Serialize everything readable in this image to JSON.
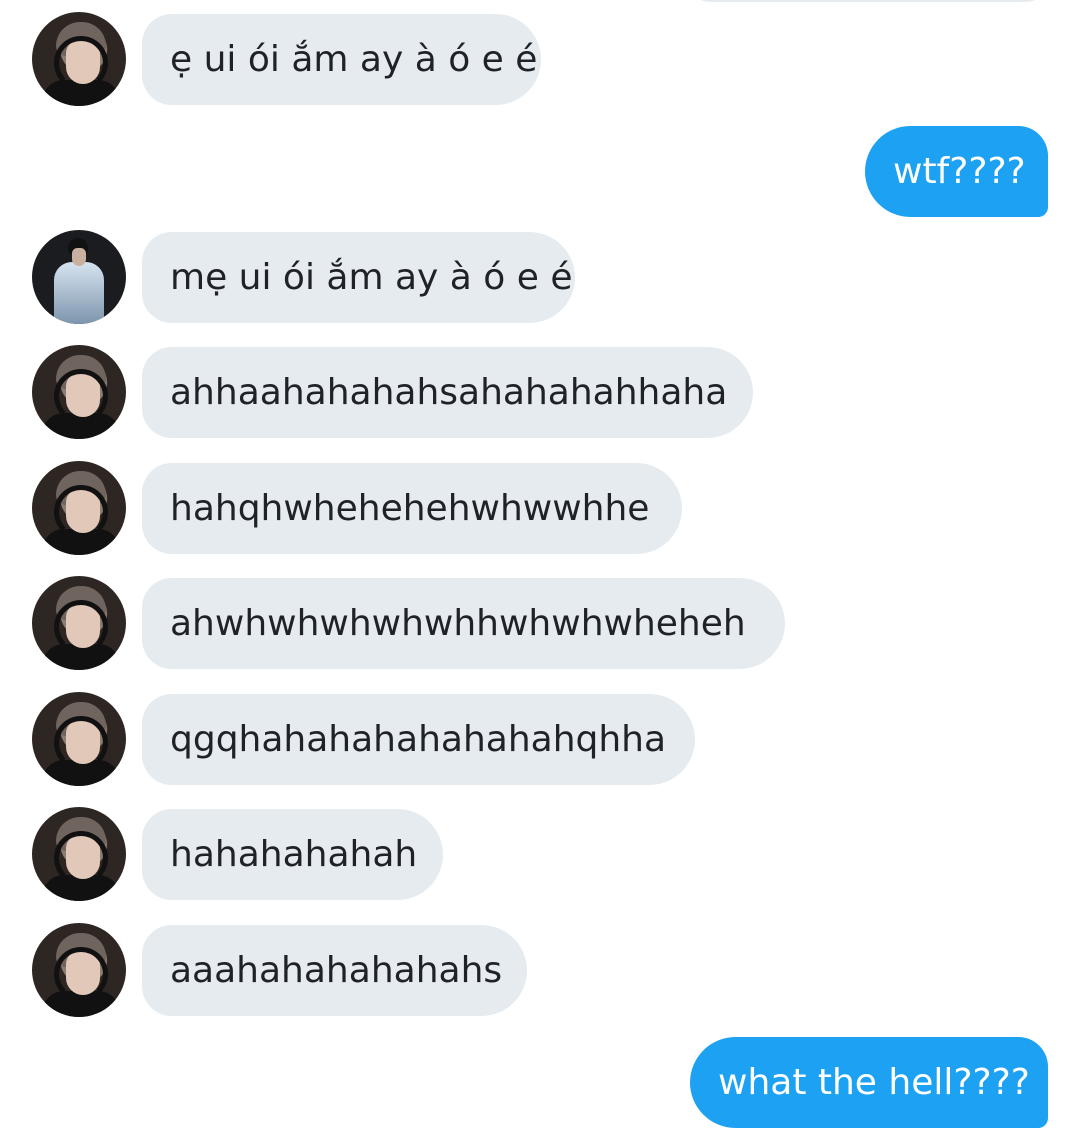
{
  "messages": [
    {
      "text": "ẹ ui ói ắm ay à ó e é",
      "sender": "other",
      "avatar": "headset-avatar"
    },
    {
      "text": "wtf????",
      "sender": "me"
    },
    {
      "text": "mẹ ui ói ắm ay à ó e é",
      "sender": "other",
      "avatar": "jacket-avatar"
    },
    {
      "text": "ahhaahahahahsahahahahhaha",
      "sender": "other",
      "avatar": "headset-avatar"
    },
    {
      "text": "hahqhwhehehehwhwwhhe",
      "sender": "other",
      "avatar": "headset-avatar"
    },
    {
      "text": "ahwhwhwhwhwhhwhwhwheheh",
      "sender": "other",
      "avatar": "headset-avatar"
    },
    {
      "text": "qgqhahahahahahahahqhha",
      "sender": "other",
      "avatar": "headset-avatar"
    },
    {
      "text": "hahahahahah",
      "sender": "other",
      "avatar": "headset-avatar"
    },
    {
      "text": "aaahahahahahahs",
      "sender": "other",
      "avatar": "headset-avatar"
    },
    {
      "text": "what the hell????",
      "sender": "me"
    }
  ],
  "colors": {
    "received_bubble": "#e6ebf0",
    "sent_bubble": "#1da1f2",
    "received_text": "#1f2227",
    "sent_text": "#ffffff",
    "background": "#ffffff"
  }
}
